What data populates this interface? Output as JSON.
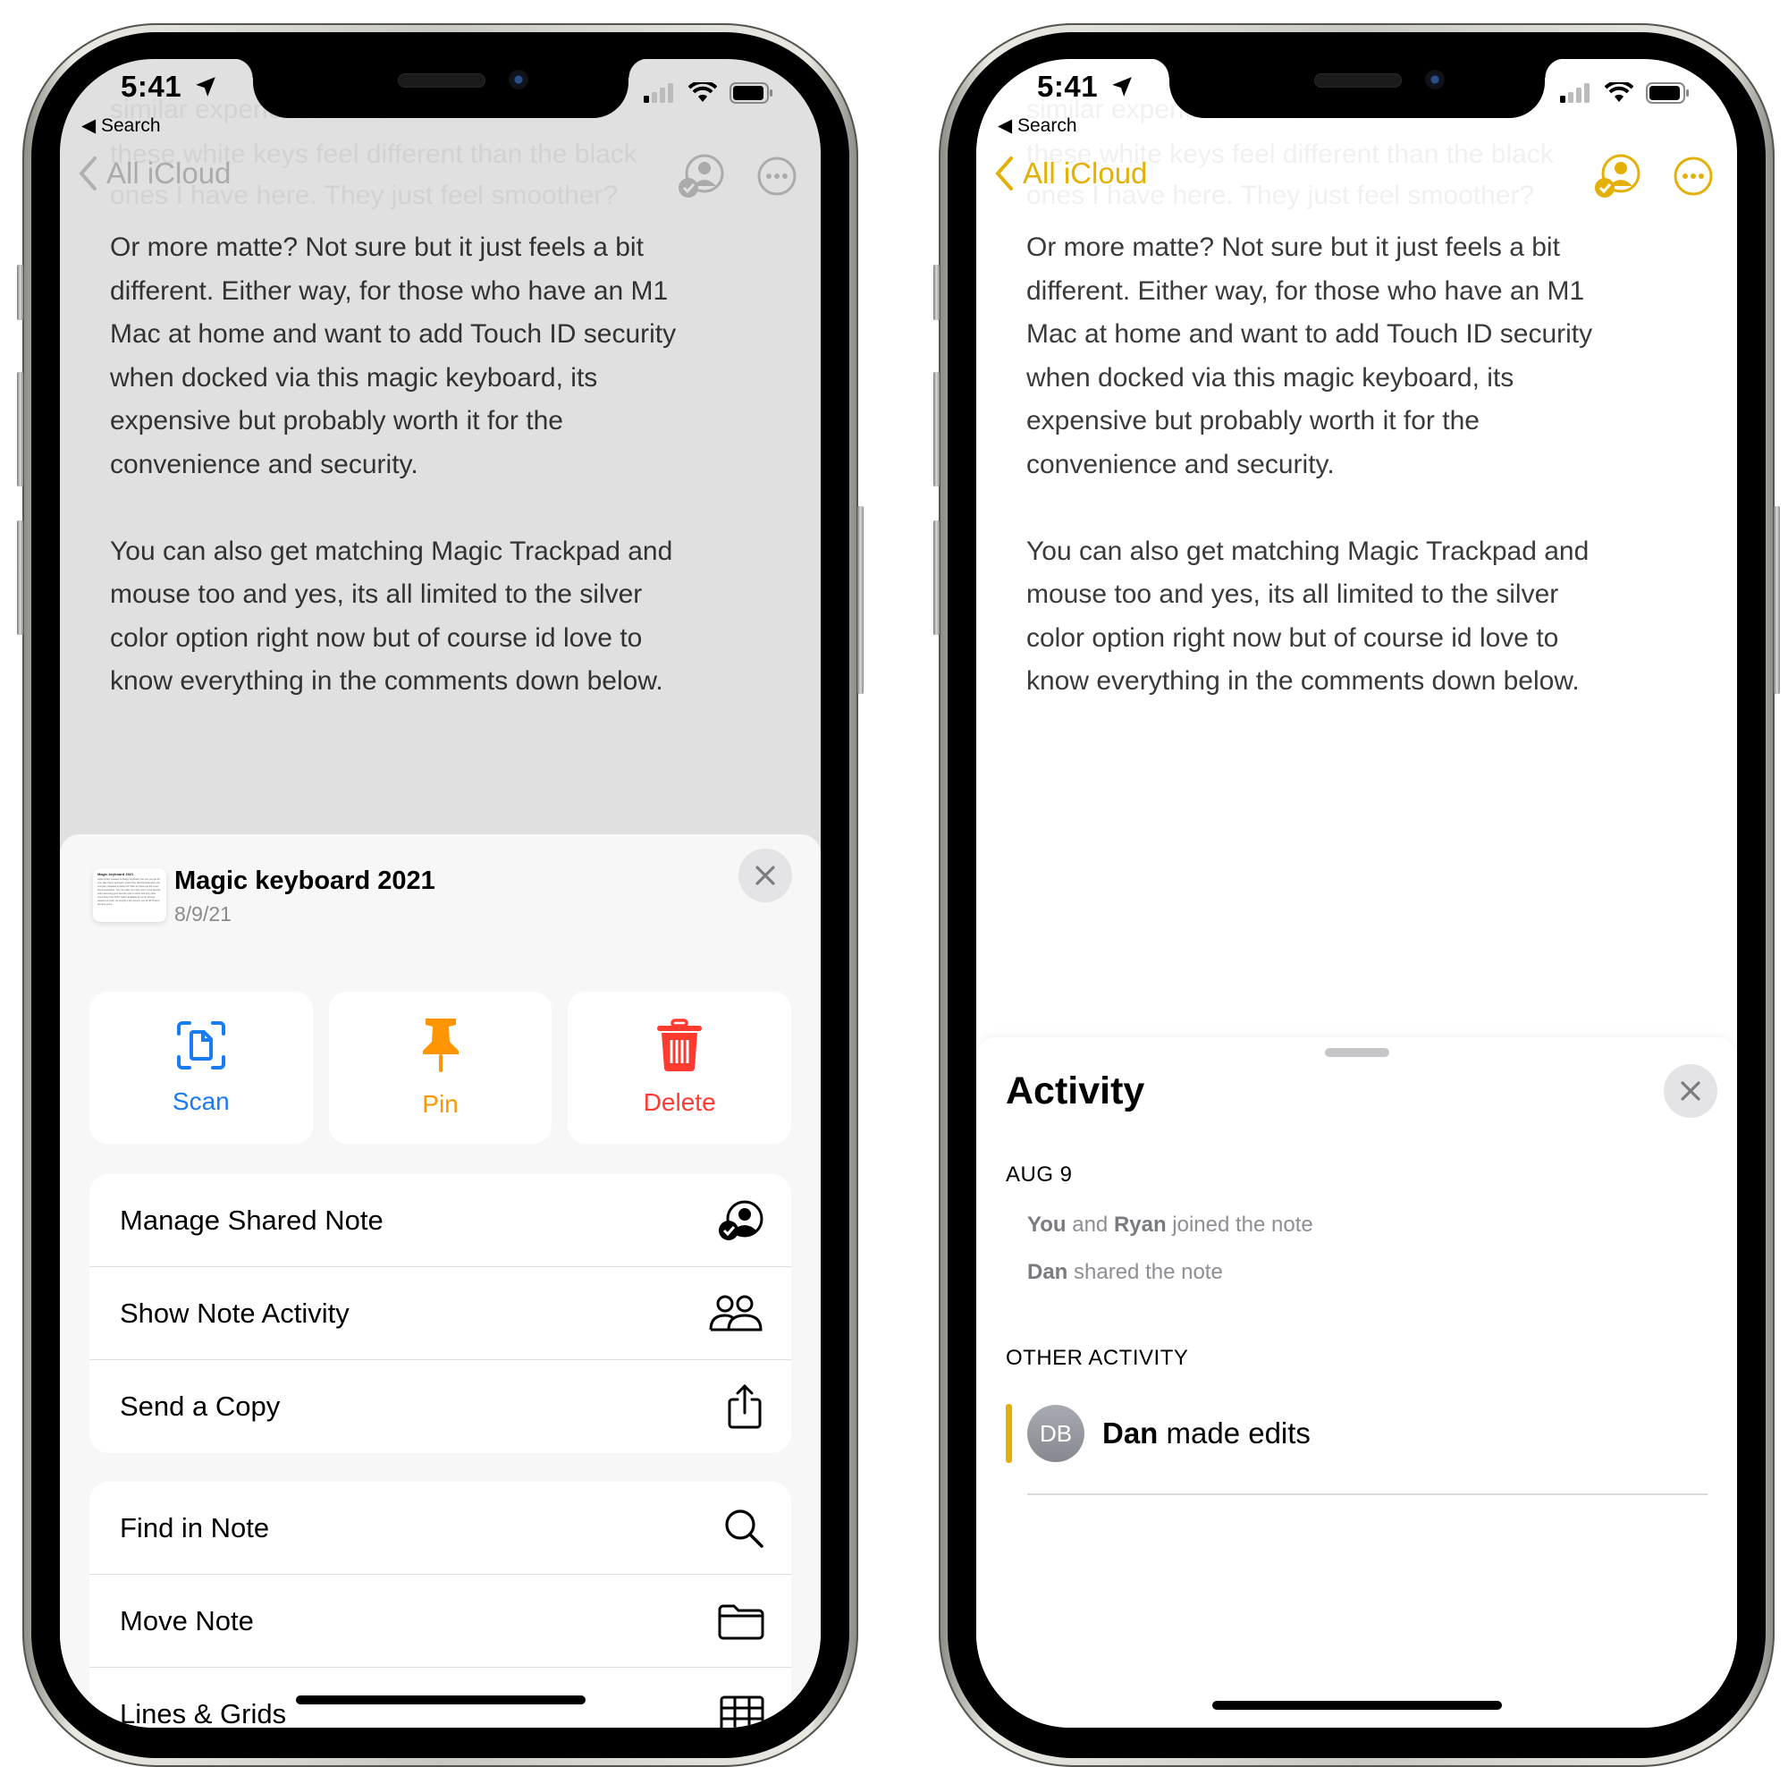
{
  "status_bar": {
    "time": "5:41",
    "back_app": "Search",
    "icons": [
      "location-arrow-icon",
      "cellular-signal-icon",
      "wifi-icon",
      "battery-icon"
    ]
  },
  "nav": {
    "back_label": "All iCloud",
    "icons": [
      "chevron-left-icon",
      "shared-person-check-icon",
      "more-ellipsis-circle-icon"
    ],
    "accent_color": "#E3B008"
  },
  "note": {
    "faded_lines": [
      "similar experience ... I think",
      "these white keys feel different than the black",
      "ones I have here. They just feel smoother?"
    ],
    "lines": [
      "Or more matte? Not sure but it just feels a bit",
      "different. Either way, for those who have an M1",
      "Mac at home and want to add Touch ID security",
      "when docked via this magic keyboard, its",
      "expensive but probably worth it for the",
      "convenience and security.",
      "",
      "You can also get matching Magic Trackpad and",
      "mouse too and yes, its all limited to the silver",
      "color option right now but of course id love to",
      "know everything in the comments down below."
    ]
  },
  "menu_sheet": {
    "thumbnail": {
      "title": "Magic keyboard 2021",
      "body": "Apple finally updated its Magic Keyboard, the one you get for your Mac that is and well I guess they did that back when the company released its latest 24\" iMac so these are the exact same keyboards. You can order one right now in your favorite color assuming your favorite color is silver and only silver since there that ONLY option available for some strange reason but yeah, we bought a full numeric one for $179 and I do have some"
    },
    "title": "Magic keyboard 2021",
    "date": "8/9/21",
    "close_icon": "close-x-icon",
    "actions": [
      {
        "label": "Scan",
        "icon": "scan-document-icon",
        "color": "#1A7CF3"
      },
      {
        "label": "Pin",
        "icon": "pin-icon",
        "color": "#FF9500"
      },
      {
        "label": "Delete",
        "icon": "trash-icon",
        "color": "#FF3B30"
      }
    ],
    "group1": [
      {
        "label": "Manage Shared Note",
        "icon": "shared-person-check-icon"
      },
      {
        "label": "Show Note Activity",
        "icon": "two-people-icon"
      },
      {
        "label": "Send a Copy",
        "icon": "share-icon"
      }
    ],
    "group2": [
      {
        "label": "Find in Note",
        "icon": "magnifying-glass-icon"
      },
      {
        "label": "Move Note",
        "icon": "folder-icon"
      },
      {
        "label": "Lines & Grids",
        "icon": "grid-icon"
      }
    ]
  },
  "activity_sheet": {
    "title": "Activity",
    "close_icon": "close-x-icon",
    "sections": [
      {
        "header": "AUG 9",
        "entries": [
          {
            "bold1": "You",
            "mid": " and ",
            "bold2": "Ryan",
            "rest": " joined the note"
          },
          {
            "bold1": "Dan",
            "rest": " shared the note"
          }
        ]
      },
      {
        "header": "OTHER ACTIVITY",
        "entries": [
          {
            "avatar_initials": "DB",
            "bold1": "Dan",
            "rest": " made edits",
            "accent_color": "#E3B008"
          }
        ]
      }
    ]
  }
}
